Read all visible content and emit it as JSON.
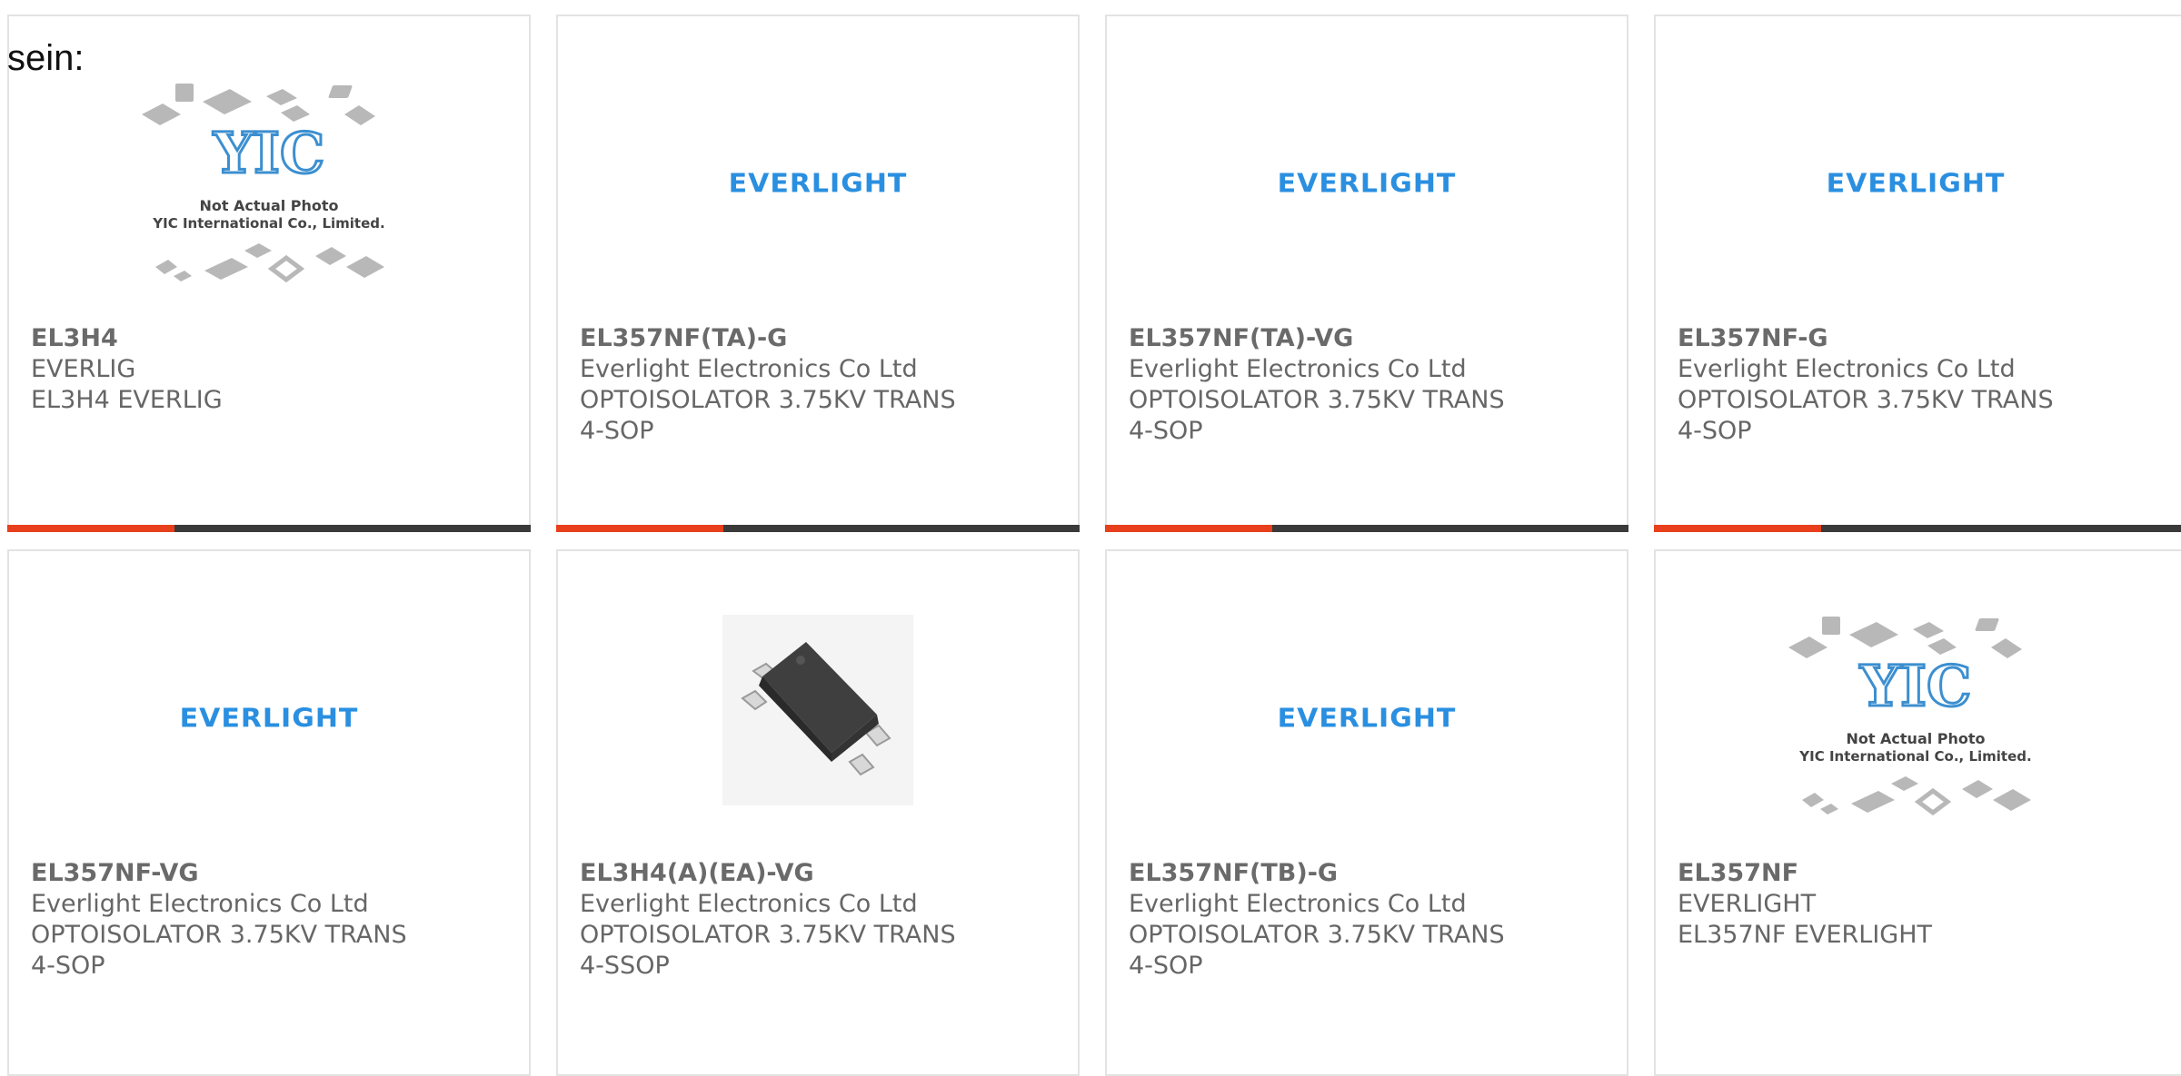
{
  "intro_text": "sein:",
  "colors": {
    "accent": "#e8401c",
    "bar": "#3a3a3a",
    "logo_blue": "#2a8fe0",
    "text": "#666666"
  },
  "yic_placeholder": {
    "line1": "Not Actual Photo",
    "line2": "YIC International Co., Limited.",
    "brand": "YIC"
  },
  "products": [
    {
      "pn": "EL3H4",
      "mfr": "EVERLIG",
      "desc": "EL3H4 EVERLIG",
      "pkg": "",
      "image": "yic-placeholder",
      "has_bar": true
    },
    {
      "pn": "EL357NF(TA)-G",
      "mfr": "Everlight Electronics Co Ltd",
      "desc": "OPTOISOLATOR 3.75KV TRANS",
      "pkg": "4-SOP",
      "image": "everlight-logo",
      "logo_text": "EVERLIGHT",
      "has_bar": true
    },
    {
      "pn": "EL357NF(TA)-VG",
      "mfr": "Everlight Electronics Co Ltd",
      "desc": "OPTOISOLATOR 3.75KV TRANS",
      "pkg": "4-SOP",
      "image": "everlight-logo",
      "logo_text": "EVERLIGHT",
      "has_bar": true
    },
    {
      "pn": "EL357NF-G",
      "mfr": "Everlight Electronics Co Ltd",
      "desc": "OPTOISOLATOR 3.75KV TRANS",
      "pkg": "4-SOP",
      "image": "everlight-logo",
      "logo_text": "EVERLIGHT",
      "has_bar": true
    },
    {
      "pn": "EL357NF-VG",
      "mfr": "Everlight Electronics Co Ltd",
      "desc": "OPTOISOLATOR 3.75KV TRANS",
      "pkg": "4-SOP",
      "image": "everlight-logo",
      "logo_text": "EVERLIGHT",
      "has_bar": false
    },
    {
      "pn": "EL3H4(A)(EA)-VG",
      "mfr": "Everlight Electronics Co Ltd",
      "desc": "OPTOISOLATOR 3.75KV TRANS",
      "pkg": "4-SSOP",
      "image": "chip-photo",
      "has_bar": false
    },
    {
      "pn": "EL357NF(TB)-G",
      "mfr": "Everlight Electronics Co Ltd",
      "desc": "OPTOISOLATOR 3.75KV TRANS",
      "pkg": "4-SOP",
      "image": "everlight-logo",
      "logo_text": "EVERLIGHT",
      "has_bar": false
    },
    {
      "pn": "EL357NF",
      "mfr": "EVERLIGHT",
      "desc": "EL357NF EVERLIGHT",
      "pkg": "",
      "image": "yic-placeholder",
      "has_bar": false
    }
  ]
}
